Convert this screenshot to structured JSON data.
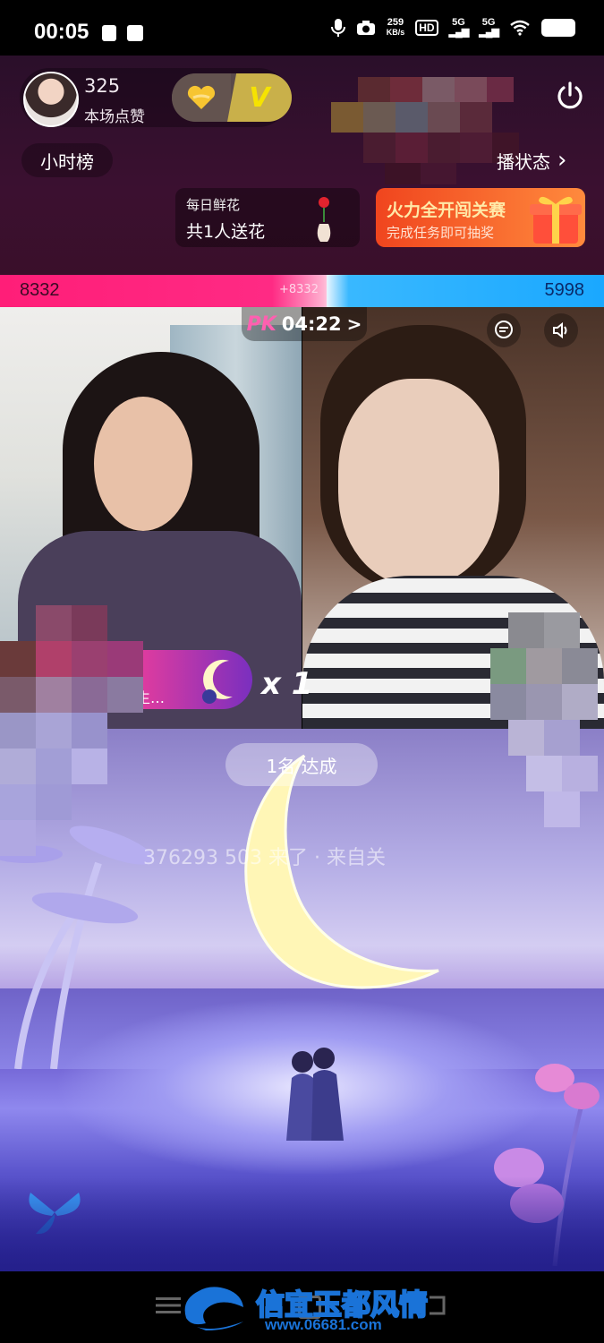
{
  "status_bar": {
    "time": "00:05",
    "net_speed_value": "259",
    "net_speed_unit": "KB/s",
    "hd_label": "HD",
    "signal_1": "5G",
    "signal_2": "5G"
  },
  "host": {
    "likes": "325",
    "likes_label": "本场点赞",
    "badge_v": "V"
  },
  "header": {
    "hour_rank": "小时榜",
    "live_status": "播状态",
    "live_status_arrow": "›"
  },
  "flower_card": {
    "title": "每日鲜花",
    "subtitle": "共1人送花"
  },
  "fire_card": {
    "title": "火力全开闯关赛",
    "subtitle": "完成任务即可抽奖"
  },
  "pk_bar": {
    "left_score": "8332",
    "right_score": "5998",
    "middle_delta": "+8332",
    "left_color": "#ff1e78",
    "right_color": "#1aa8ff"
  },
  "pk_timer": {
    "logo": "PK",
    "time": "04:22",
    "arrow": ">"
  },
  "gift_banner": {
    "sender_suffix": "生…",
    "count": "x 1"
  },
  "overlay": {
    "goal_text": "1名      达成",
    "welcome_text": "376293     503 来了 · 来自关"
  },
  "watermark": {
    "title": "信宜玉都风情",
    "url": "www.06681.com"
  },
  "icons": {
    "power": "power-icon",
    "chat": "comment-icon",
    "sound": "speaker-icon",
    "gift": "gift-box-icon"
  }
}
